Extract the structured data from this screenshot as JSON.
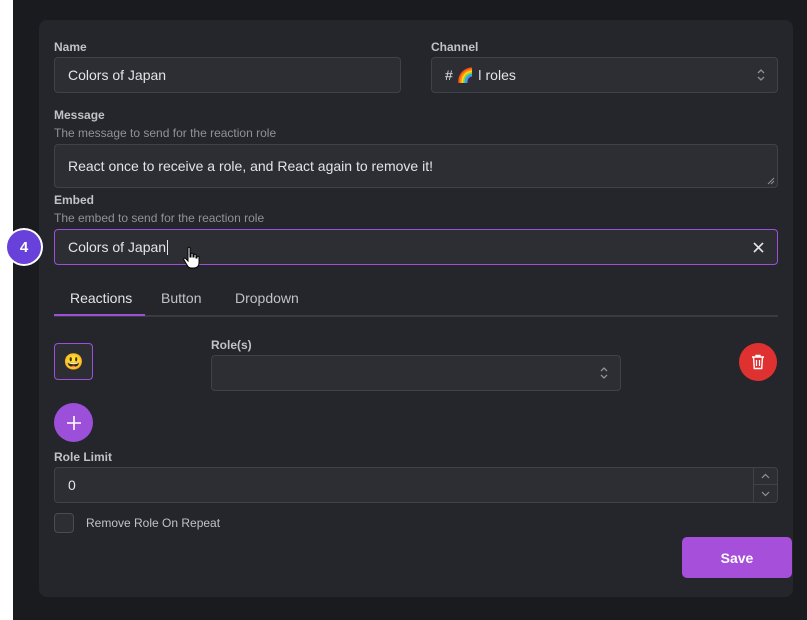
{
  "form": {
    "name_label": "Name",
    "name_value": "Colors of Japan",
    "channel_label": "Channel",
    "channel_value": "# 🌈 ǀ roles",
    "message_label": "Message",
    "message_desc": "The message to send for the reaction role",
    "message_value": "React once to receive a role, and React again to remove it!",
    "embed_label": "Embed",
    "embed_desc": "The embed to send for the reaction role",
    "embed_value": "Colors of Japan"
  },
  "tabs": [
    {
      "label": "Reactions",
      "active": true
    },
    {
      "label": "Button",
      "active": false
    },
    {
      "label": "Dropdown",
      "active": false
    }
  ],
  "reaction_row": {
    "emoji": "😃",
    "roles_label": "Role(s)",
    "roles_value": ""
  },
  "role_limit": {
    "label": "Role Limit",
    "value": "0"
  },
  "remove_on_repeat": {
    "label": "Remove Role On Repeat",
    "checked": false
  },
  "save_label": "Save",
  "step_badge": "4",
  "colors": {
    "accent": "#9c4fd9",
    "danger": "#e03131",
    "badge": "#6741d9"
  }
}
